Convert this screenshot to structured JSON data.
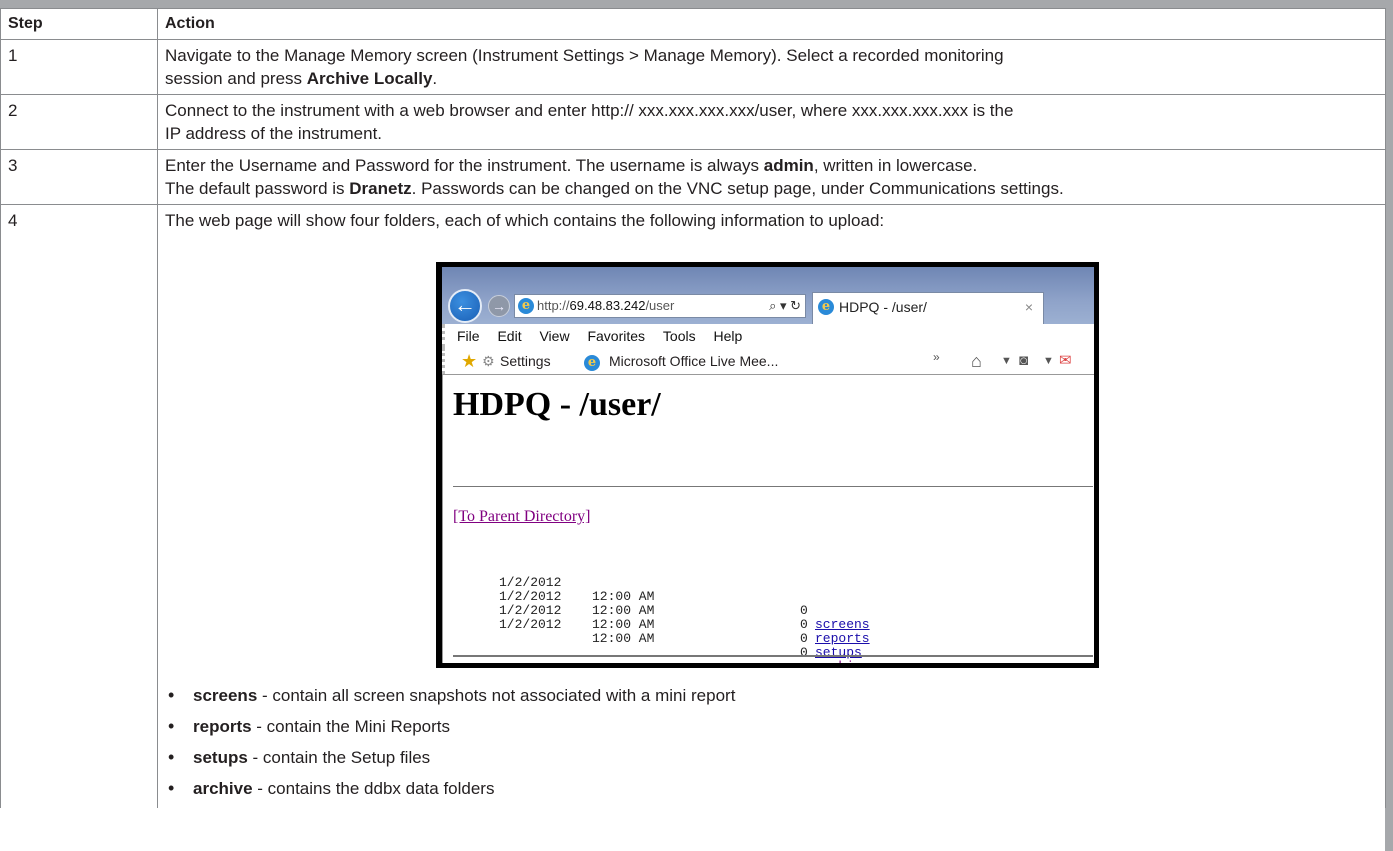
{
  "table": {
    "headers": {
      "step": "Step",
      "action": "Action"
    },
    "rows": [
      {
        "step": "1",
        "line1": "Navigate to the Manage Memory screen (Instrument Settings > Manage Memory). Select a recorded monitoring",
        "line2_pre": "session and press ",
        "line2_bold": "Archive Locally",
        "line2_post": "."
      },
      {
        "step": "2",
        "line1": "Connect to the instrument with a web browser and enter http:// xxx.xxx.xxx.xxx/user, where xxx.xxx.xxx.xxx is the",
        "line2": "IP address of the instrument."
      },
      {
        "step": "3",
        "line1_pre": "Enter the Username and Password for the instrument. The username is always ",
        "line1_bold": "admin",
        "line1_post": ", written in lowercase.",
        "line2_pre": "The default password is ",
        "line2_bold": "Dranetz",
        "line2_post": ". Passwords can be changed on the VNC setup page, under Communications settings."
      },
      {
        "step": "4",
        "intro": "The web page will show four folders, each of which contains the following information to upload:"
      }
    ]
  },
  "browser": {
    "address_prefix": "http://",
    "address_host": "69.48.83.242",
    "address_path": "/user",
    "address_controls": "⌕ ▾ ↻",
    "tab_title": "HDPQ - /user/",
    "tab_close": "×",
    "menu": [
      "File",
      "Edit",
      "View",
      "Favorites",
      "Tools",
      "Help"
    ],
    "fav_settings": "Settings",
    "fav_office": "Microsoft Office Live Mee...",
    "page_heading": "HDPQ - /user/",
    "parent_link": "[To Parent Directory]",
    "listing": [
      {
        "date": "1/2/2012",
        "time": "12:00 AM",
        "size": "0",
        "name": "screens"
      },
      {
        "date": "1/2/2012",
        "time": "12:00 AM",
        "size": "0",
        "name": "reports"
      },
      {
        "date": "1/2/2012",
        "time": "12:00 AM",
        "size": "0",
        "name": "setups"
      },
      {
        "date": "1/2/2012",
        "time": "12:00 AM",
        "size": "0",
        "name": "archive"
      }
    ]
  },
  "folders": [
    {
      "name": "screens",
      "desc": " - contain all screen snapshots not associated with a mini report"
    },
    {
      "name": "reports",
      "desc": " - contain the Mini Reports"
    },
    {
      "name": "setups",
      "desc": " - contain the Setup files"
    },
    {
      "name": "archive",
      "desc": " - contains the ddbx data folders"
    }
  ],
  "colors": {
    "border": "#a6a8ab",
    "grid": "#8a8c8f",
    "text": "#231f20",
    "visited": "#800080"
  }
}
